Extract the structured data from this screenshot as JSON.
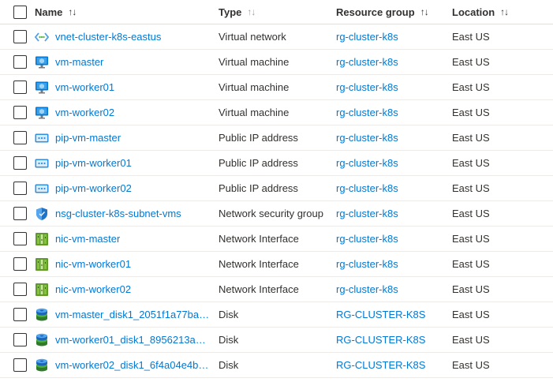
{
  "columns": {
    "name": "Name",
    "type": "Type",
    "resource_group": "Resource group",
    "location": "Location",
    "sort_glyph": "↑↓"
  },
  "rows": [
    {
      "name": "vnet-cluster-k8s-eastus",
      "icon": "virtual-network-icon",
      "type": "Virtual network",
      "resource_group": "rg-cluster-k8s",
      "location": "East US"
    },
    {
      "name": "vm-master",
      "icon": "virtual-machine-icon",
      "type": "Virtual machine",
      "resource_group": "rg-cluster-k8s",
      "location": "East US"
    },
    {
      "name": "vm-worker01",
      "icon": "virtual-machine-icon",
      "type": "Virtual machine",
      "resource_group": "rg-cluster-k8s",
      "location": "East US"
    },
    {
      "name": "vm-worker02",
      "icon": "virtual-machine-icon",
      "type": "Virtual machine",
      "resource_group": "rg-cluster-k8s",
      "location": "East US"
    },
    {
      "name": "pip-vm-master",
      "icon": "public-ip-icon",
      "type": "Public IP address",
      "resource_group": "rg-cluster-k8s",
      "location": "East US"
    },
    {
      "name": "pip-vm-worker01",
      "icon": "public-ip-icon",
      "type": "Public IP address",
      "resource_group": "rg-cluster-k8s",
      "location": "East US"
    },
    {
      "name": "pip-vm-worker02",
      "icon": "public-ip-icon",
      "type": "Public IP address",
      "resource_group": "rg-cluster-k8s",
      "location": "East US"
    },
    {
      "name": "nsg-cluster-k8s-subnet-vms",
      "icon": "network-security-group-icon",
      "type": "Network security group",
      "resource_group": "rg-cluster-k8s",
      "location": "East US"
    },
    {
      "name": "nic-vm-master",
      "icon": "network-interface-icon",
      "type": "Network Interface",
      "resource_group": "rg-cluster-k8s",
      "location": "East US"
    },
    {
      "name": "nic-vm-worker01",
      "icon": "network-interface-icon",
      "type": "Network Interface",
      "resource_group": "rg-cluster-k8s",
      "location": "East US"
    },
    {
      "name": "nic-vm-worker02",
      "icon": "network-interface-icon",
      "type": "Network Interface",
      "resource_group": "rg-cluster-k8s",
      "location": "East US"
    },
    {
      "name": "vm-master_disk1_2051f1a77bad…",
      "icon": "disk-icon",
      "type": "Disk",
      "resource_group": "RG-CLUSTER-K8S",
      "location": "East US"
    },
    {
      "name": "vm-worker01_disk1_8956213a3e…",
      "icon": "disk-icon",
      "type": "Disk",
      "resource_group": "RG-CLUSTER-K8S",
      "location": "East US"
    },
    {
      "name": "vm-worker02_disk1_6f4a04e4bd…",
      "icon": "disk-icon",
      "type": "Disk",
      "resource_group": "RG-CLUSTER-K8S",
      "location": "East US"
    }
  ],
  "colors": {
    "link": "#0078d4",
    "text": "#323130",
    "divider": "#edebe9"
  }
}
